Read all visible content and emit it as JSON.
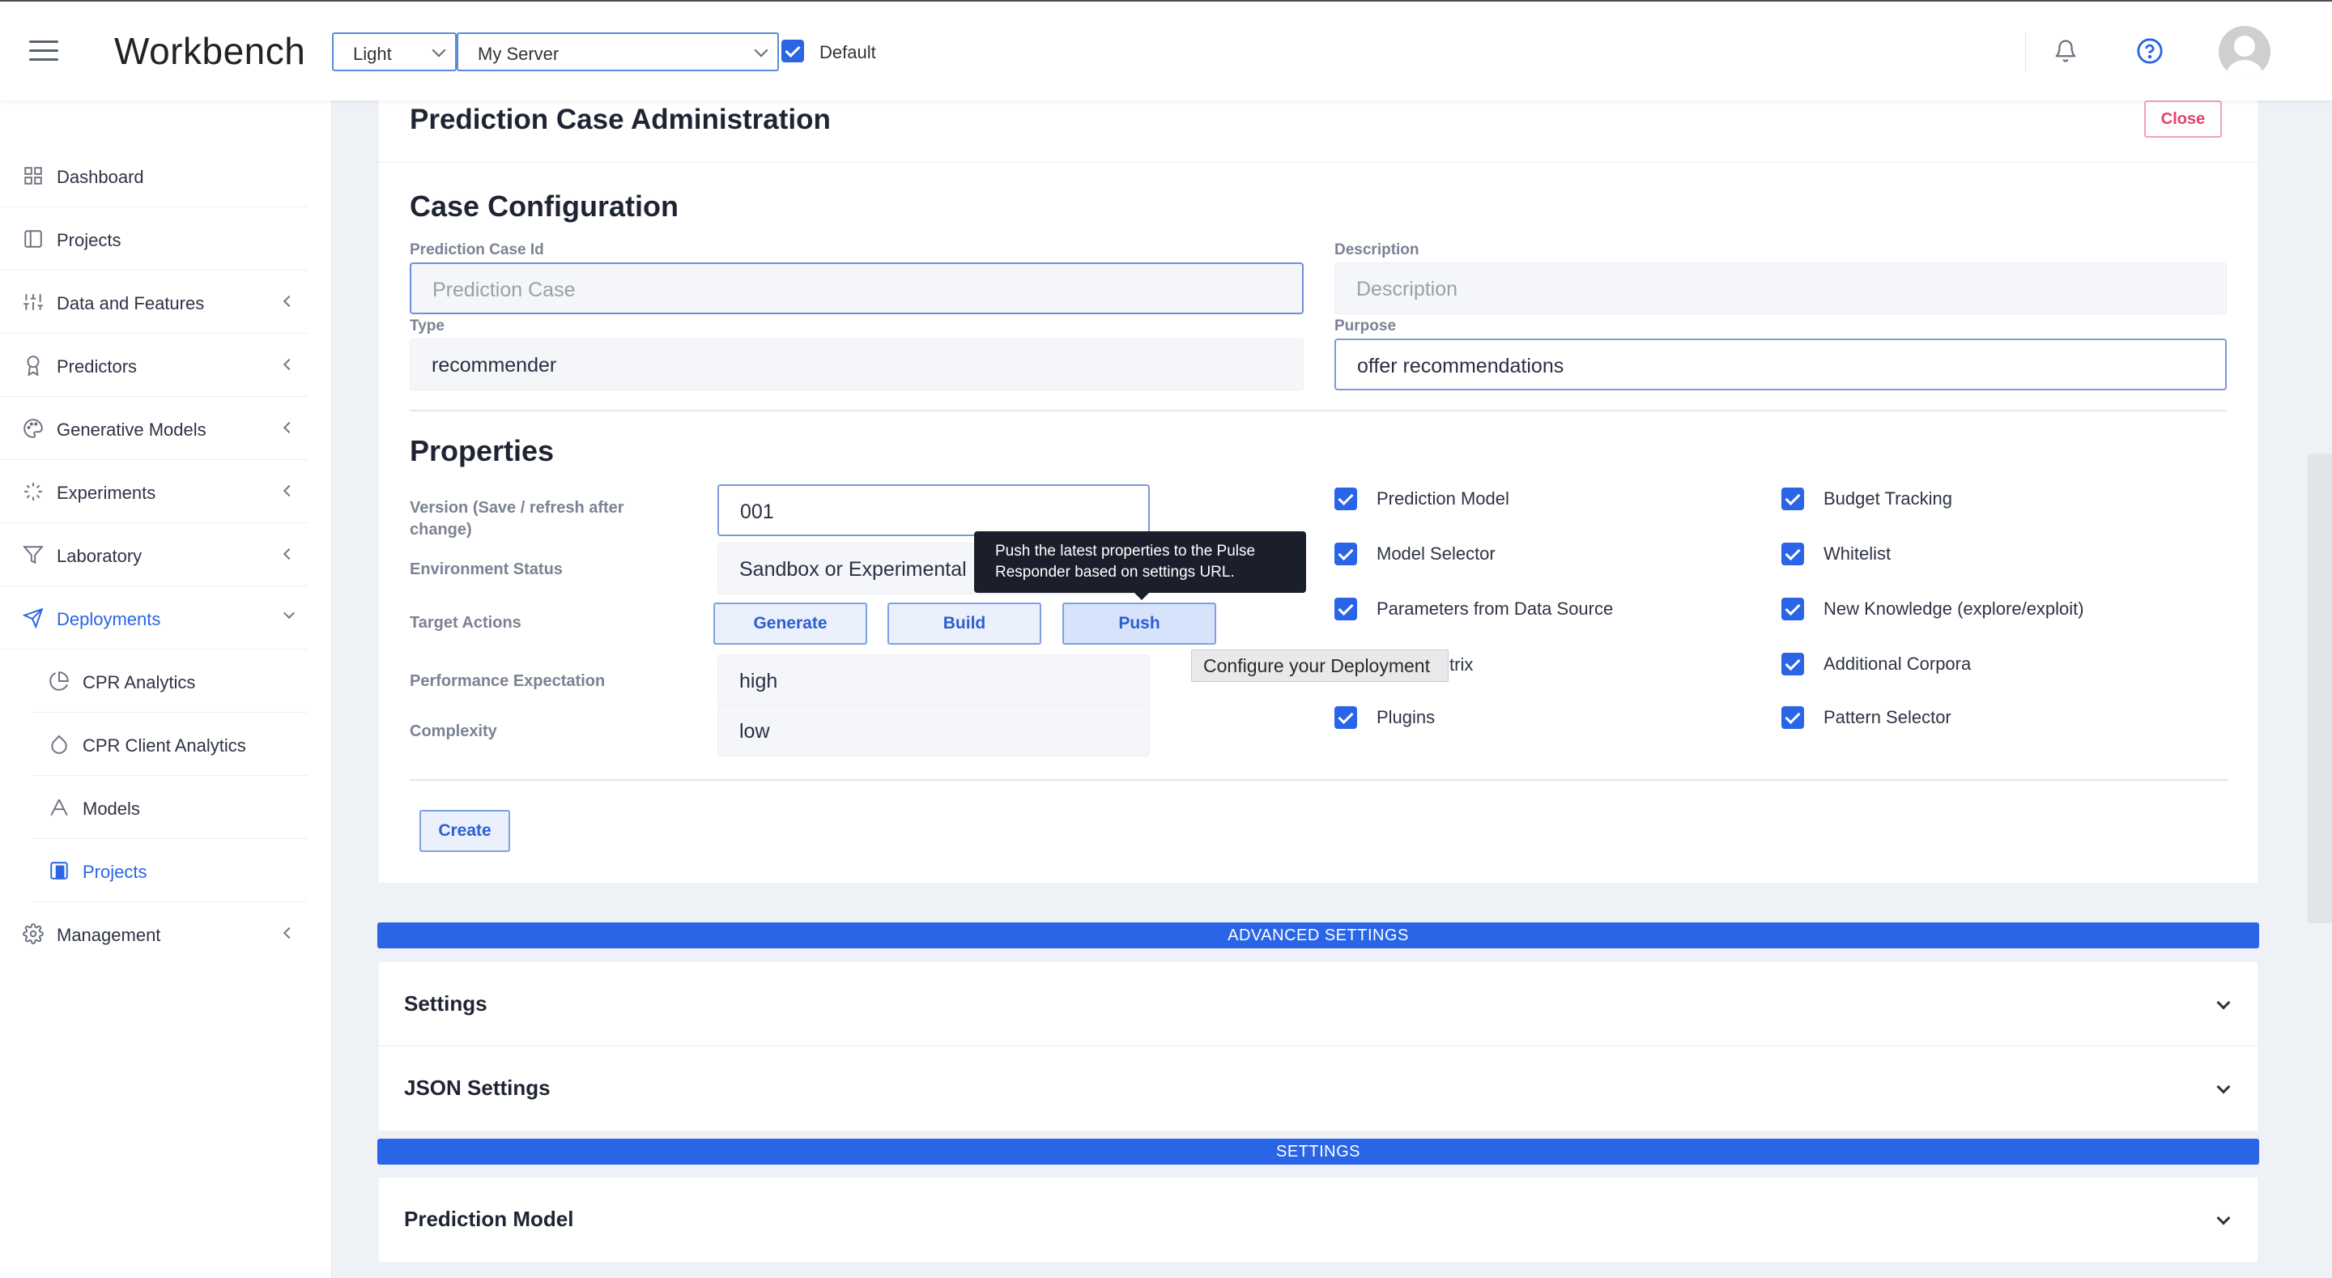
{
  "topbar": {
    "app_title": "Workbench",
    "theme_select": "Light",
    "server_select": "My Server",
    "default_label": "Default"
  },
  "sidebar": {
    "items": [
      {
        "label": "Dashboard",
        "icon": "grid-icon"
      },
      {
        "label": "Projects",
        "icon": "book-icon"
      },
      {
        "label": "Data and Features",
        "icon": "sliders-icon"
      },
      {
        "label": "Predictors",
        "icon": "award-icon"
      },
      {
        "label": "Generative Models",
        "icon": "palette-icon"
      },
      {
        "label": "Experiments",
        "icon": "loader-icon"
      },
      {
        "label": "Laboratory",
        "icon": "filter-icon"
      },
      {
        "label": "Deployments",
        "icon": "send-icon"
      },
      {
        "label": "CPR Analytics",
        "icon": "pie-chart-icon"
      },
      {
        "label": "CPR Client Analytics",
        "icon": "droplet-icon"
      },
      {
        "label": "Models",
        "icon": "pen-tool-icon"
      },
      {
        "label": "Projects",
        "icon": "book-icon"
      },
      {
        "label": "Management",
        "icon": "gear-icon"
      }
    ]
  },
  "card": {
    "title": "Prediction Case Administration",
    "close_label": "Close",
    "case_config": {
      "title": "Case Configuration",
      "id_label": "Prediction Case Id",
      "id_placeholder": "Prediction Case",
      "description_label": "Description",
      "description_placeholder": "Description",
      "type_label": "Type",
      "type_value": "recommender",
      "purpose_label": "Purpose",
      "purpose_value": "offer recommendations"
    },
    "properties": {
      "title": "Properties",
      "version_label": "Version (Save / refresh after change)",
      "version_value": "001",
      "env_label": "Environment Status",
      "env_value": "Sandbox or Experimental",
      "target_label": "Target Actions",
      "generate_label": "Generate",
      "build_label": "Build",
      "push_label": "Push",
      "perf_label": "Performance Expectation",
      "perf_value": "high",
      "complexity_label": "Complexity",
      "complexity_value": "low",
      "checks_left": [
        "Prediction Model",
        "Model Selector",
        "Parameters from Data Source",
        "trix",
        "Plugins"
      ],
      "checks_right": [
        "Budget Tracking",
        "Whitelist",
        "New Knowledge (explore/exploit)",
        "Additional Corpora",
        "Pattern Selector"
      ]
    },
    "create_label": "Create",
    "tooltip": "Push the latest properties to the Pulse Responder based on settings URL.",
    "hint": "Configure your Deployment"
  },
  "advanced": {
    "banner": "ADVANCED SETTINGS",
    "panels": [
      "Settings",
      "JSON Settings"
    ]
  },
  "settings": {
    "banner": "SETTINGS",
    "panels": [
      "Prediction Model"
    ]
  },
  "colors": {
    "accent": "#2965e6",
    "close_red": "#e3426a",
    "tooltip_bg": "#1b1f2b"
  }
}
